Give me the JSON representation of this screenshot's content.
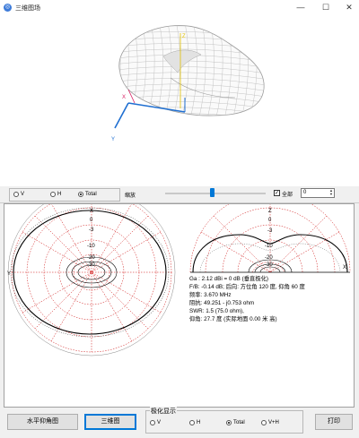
{
  "window": {
    "title": "三维图场",
    "icon": "app-icon",
    "minimize": "—",
    "maximize": "☐",
    "close": "✕"
  },
  "view3d": {
    "axis_z": "Z",
    "axis_x": "X",
    "axis_y": "Y"
  },
  "toolbar": {
    "radio_v": "V",
    "radio_h": "H",
    "radio_total": "Total",
    "selected": "Total",
    "zoom_label": "缩放",
    "slider_level": 0.46,
    "all_label": "全部",
    "all_checked": true,
    "spin_value": "0"
  },
  "plots": {
    "left": {
      "top_axis": "X",
      "side_axis": "Y",
      "ticks": [
        "0",
        "-3",
        "-10",
        "-20",
        "-30"
      ]
    },
    "right": {
      "top_axis": "Z",
      "side_axis": "X",
      "ticks": [
        "0",
        "-3",
        "-10",
        "-20",
        "-30"
      ]
    }
  },
  "info": {
    "ga": "Ga : 2.12 dBi = 0 dB (垂直极化)",
    "fb": "F/B: -0.14 dB; 后向: 方位角 120 度, 仰角 60 度",
    "freq": "频率: 3.670 MHz",
    "impedance": "阻抗: 49.251 - j0.753 ohm",
    "swr": "SWR: 1.5 (75.0 ohm),",
    "elevation": "仰角: 27.7 度 (实际地面  0.00 米 高)"
  },
  "bottom": {
    "btn_elev": "水平仰角图",
    "btn_3d": "三维图",
    "pol_legend": "极化显示",
    "pol_v": "V",
    "pol_h": "H",
    "pol_total": "Total",
    "pol_vh": "V+H",
    "pol_selected": "Total",
    "btn_print": "打印"
  },
  "colors": {
    "accent": "#0078d7",
    "pattern": "#000000",
    "grid": "#cc0000",
    "axis3d": "#1f6fd1"
  }
}
